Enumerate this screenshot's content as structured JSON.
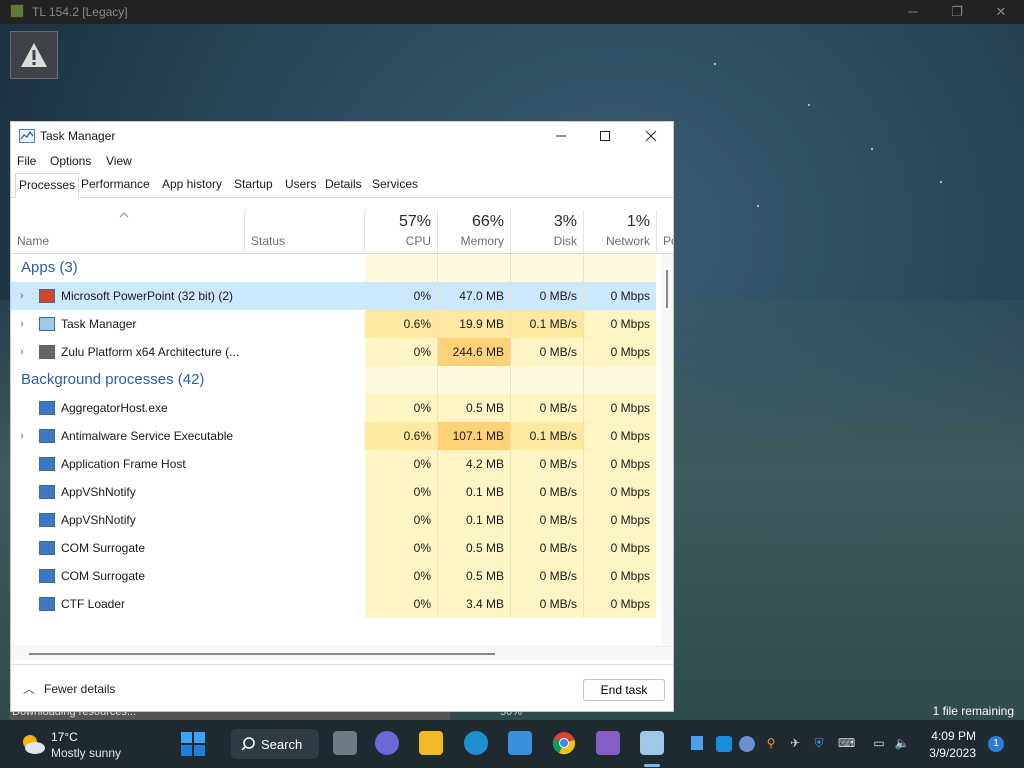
{
  "game_window": {
    "title": "TL 154.2 [Legacy]",
    "loading_text": "Downloading resources...",
    "loading_pct": "50%",
    "files_remaining": "1 file remaining"
  },
  "task_manager": {
    "title": "Task Manager",
    "menu": [
      "File",
      "Options",
      "View"
    ],
    "tabs": [
      "Processes",
      "Performance",
      "App history",
      "Startup",
      "Users",
      "Details",
      "Services"
    ],
    "columns": {
      "name": "Name",
      "status": "Status",
      "cpu": {
        "pct": "57%",
        "label": "CPU"
      },
      "memory": {
        "pct": "66%",
        "label": "Memory"
      },
      "disk": {
        "pct": "3%",
        "label": "Disk"
      },
      "network": {
        "pct": "1%",
        "label": "Network"
      },
      "power": "Po"
    },
    "groups": {
      "apps": "Apps (3)",
      "background": "Background processes (42)"
    },
    "apps": [
      {
        "name": "Microsoft PowerPoint (32 bit) (2)",
        "cpu": "0%",
        "mem": "47.0 MB",
        "disk": "0 MB/s",
        "net": "0 Mbps"
      },
      {
        "name": "Task Manager",
        "cpu": "0.6%",
        "mem": "19.9 MB",
        "disk": "0.1 MB/s",
        "net": "0 Mbps"
      },
      {
        "name": "Zulu Platform x64 Architecture (...",
        "cpu": "0%",
        "mem": "244.6 MB",
        "disk": "0 MB/s",
        "net": "0 Mbps"
      }
    ],
    "background": [
      {
        "name": "AggregatorHost.exe",
        "cpu": "0%",
        "mem": "0.5 MB",
        "disk": "0 MB/s",
        "net": "0 Mbps"
      },
      {
        "name": "Antimalware Service Executable",
        "cpu": "0.6%",
        "mem": "107.1 MB",
        "disk": "0.1 MB/s",
        "net": "0 Mbps"
      },
      {
        "name": "Application Frame Host",
        "cpu": "0%",
        "mem": "4.2 MB",
        "disk": "0 MB/s",
        "net": "0 Mbps"
      },
      {
        "name": "AppVShNotify",
        "cpu": "0%",
        "mem": "0.1 MB",
        "disk": "0 MB/s",
        "net": "0 Mbps"
      },
      {
        "name": "AppVShNotify",
        "cpu": "0%",
        "mem": "0.1 MB",
        "disk": "0 MB/s",
        "net": "0 Mbps"
      },
      {
        "name": "COM Surrogate",
        "cpu": "0%",
        "mem": "0.5 MB",
        "disk": "0 MB/s",
        "net": "0 Mbps"
      },
      {
        "name": "COM Surrogate",
        "cpu": "0%",
        "mem": "0.5 MB",
        "disk": "0 MB/s",
        "net": "0 Mbps"
      },
      {
        "name": "CTF Loader",
        "cpu": "0%",
        "mem": "3.4 MB",
        "disk": "0 MB/s",
        "net": "0 Mbps"
      }
    ],
    "footer": {
      "fewer_details": "Fewer details",
      "end_task": "End task"
    }
  },
  "taskbar": {
    "weather_temp": "17°C",
    "weather_desc": "Mostly sunny",
    "search": "Search",
    "time": "4:09 PM",
    "date": "3/9/2023",
    "notifications": "1"
  }
}
